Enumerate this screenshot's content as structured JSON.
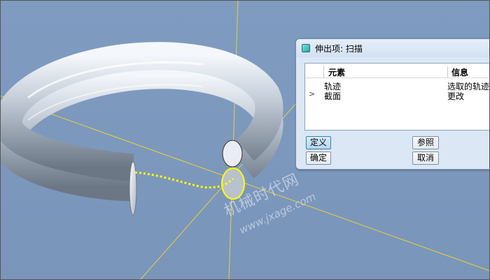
{
  "dialog": {
    "title": "伸出项: 扫描",
    "columns": {
      "element": "元素",
      "info": "信息"
    },
    "rows": [
      {
        "expander": "",
        "element": "轨迹",
        "info": "选取的轨迹"
      },
      {
        "expander": ">",
        "element": "截面",
        "info": "更改"
      }
    ],
    "buttons": {
      "define": "定义",
      "reference": "参照",
      "ok": "确定",
      "cancel": "取消"
    }
  },
  "watermark": {
    "name": "机械时代网",
    "url": "www.jxage.com"
  },
  "colors": {
    "viewport_bg": "#7d98bd",
    "trajectory": "#ffff00",
    "datum_axis": "#e6d33a",
    "dialog_bg": "#dbe7f5"
  }
}
